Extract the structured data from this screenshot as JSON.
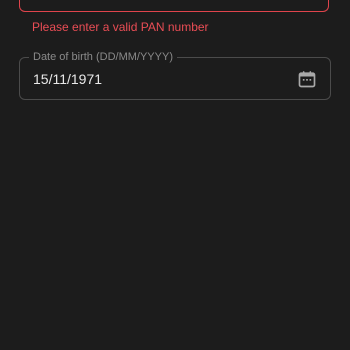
{
  "pan": {
    "error": "Please enter a valid PAN number"
  },
  "dob": {
    "label": "Date of birth (DD/MM/YYYY)",
    "value": "15/11/1971",
    "icon": "calendar-icon"
  },
  "colors": {
    "background": "#1c1c1c",
    "error": "#ea4d55",
    "field_border": "#4b4b4b",
    "text": "#e9e9e9",
    "label": "#8a8a8a"
  }
}
